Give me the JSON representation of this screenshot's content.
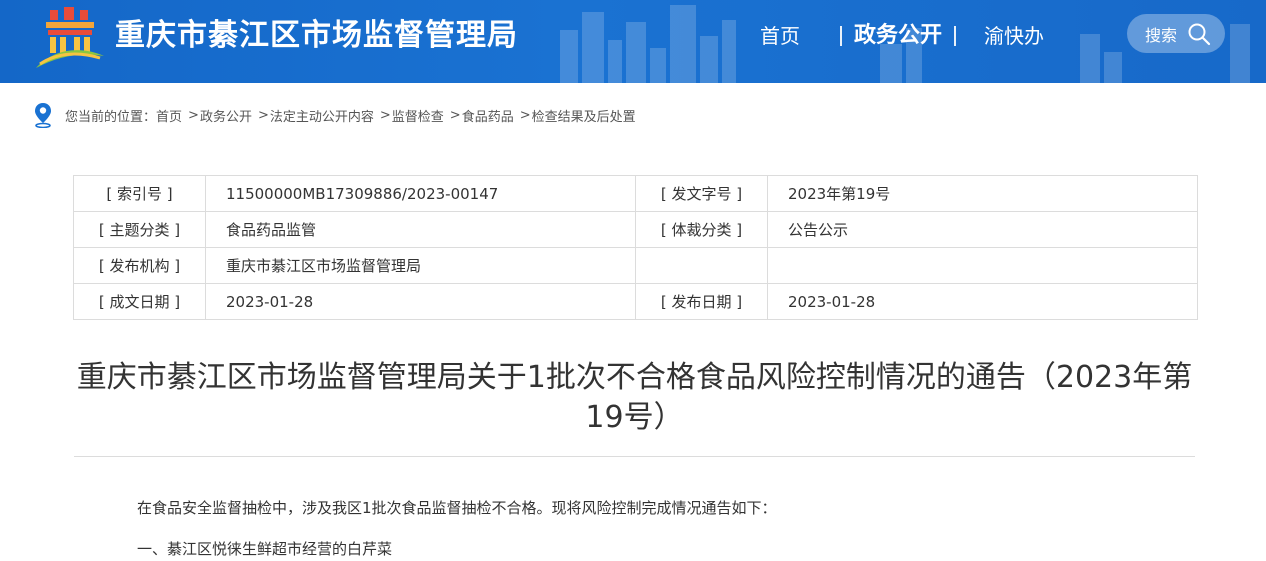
{
  "header": {
    "site_title": "重庆市綦江区市场监督管理局",
    "nav": [
      "首页",
      "政务公开",
      "渝快办"
    ],
    "active_nav": "政务公开",
    "search_label": "搜索",
    "colors": {
      "header_bg": "#1a72d2",
      "text": "#ffffff"
    }
  },
  "breadcrumb": {
    "prefix": "您当前的位置：",
    "items": [
      "首页",
      "政务公开",
      "法定主动公开内容",
      "监督检查",
      "食品药品",
      "检查结果及后处置"
    ]
  },
  "info_table": {
    "rows": [
      {
        "k1": "[ 索引号 ]",
        "v1": "11500000MB17309886/2023-00147",
        "k2": "[ 发文字号 ]",
        "v2": "2023年第19号"
      },
      {
        "k1": "[ 主题分类 ]",
        "v1": "食品药品监管",
        "k2": "[ 体裁分类 ]",
        "v2": "公告公示"
      },
      {
        "k1": "[ 发布机构 ]",
        "v1": "重庆市綦江区市场监督管理局",
        "k2": "",
        "v2": ""
      },
      {
        "k1": "[ 成文日期 ]",
        "v1": "2023-01-28",
        "k2": "[ 发布日期 ]",
        "v2": "2023-01-28"
      }
    ]
  },
  "article": {
    "title_line1": "重庆市綦江区市场监督管理局关于1批次不合格食品风险控制情况的通告（2023年第",
    "title_line2": "19号）",
    "paragraphs": [
      "在食品安全监督抽检中，涉及我区1批次食品监督抽检不合格。现将风险控制完成情况通告如下：",
      "一、綦江区悦徕生鲜超市经营的白芹菜"
    ]
  }
}
